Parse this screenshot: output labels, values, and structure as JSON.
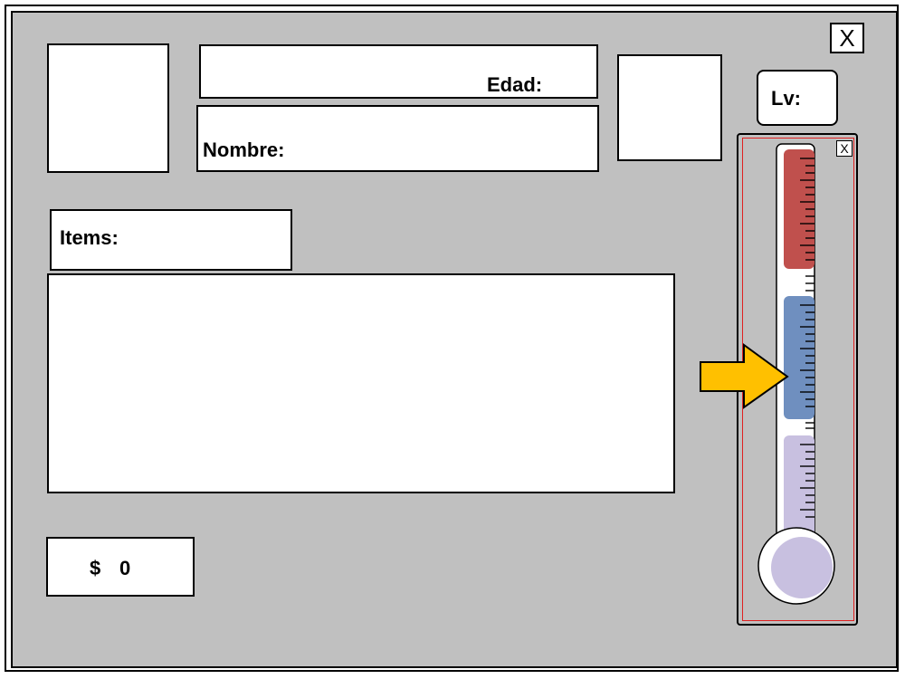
{
  "window": {
    "close_label": "X"
  },
  "profile": {
    "edad_label": "Edad:",
    "nombre_label": "Nombre:",
    "lv_label": "Lv:"
  },
  "items": {
    "label": "Items:"
  },
  "money": {
    "symbol": "$",
    "amount": "0"
  },
  "thermometer": {
    "close_label": "X",
    "pointer_icon": "arrow-right-icon",
    "colors": {
      "red": "#c0504d",
      "blue": "#6f8fbf",
      "lavender": "#c8c0e0",
      "arrow": "#ffc000"
    }
  }
}
